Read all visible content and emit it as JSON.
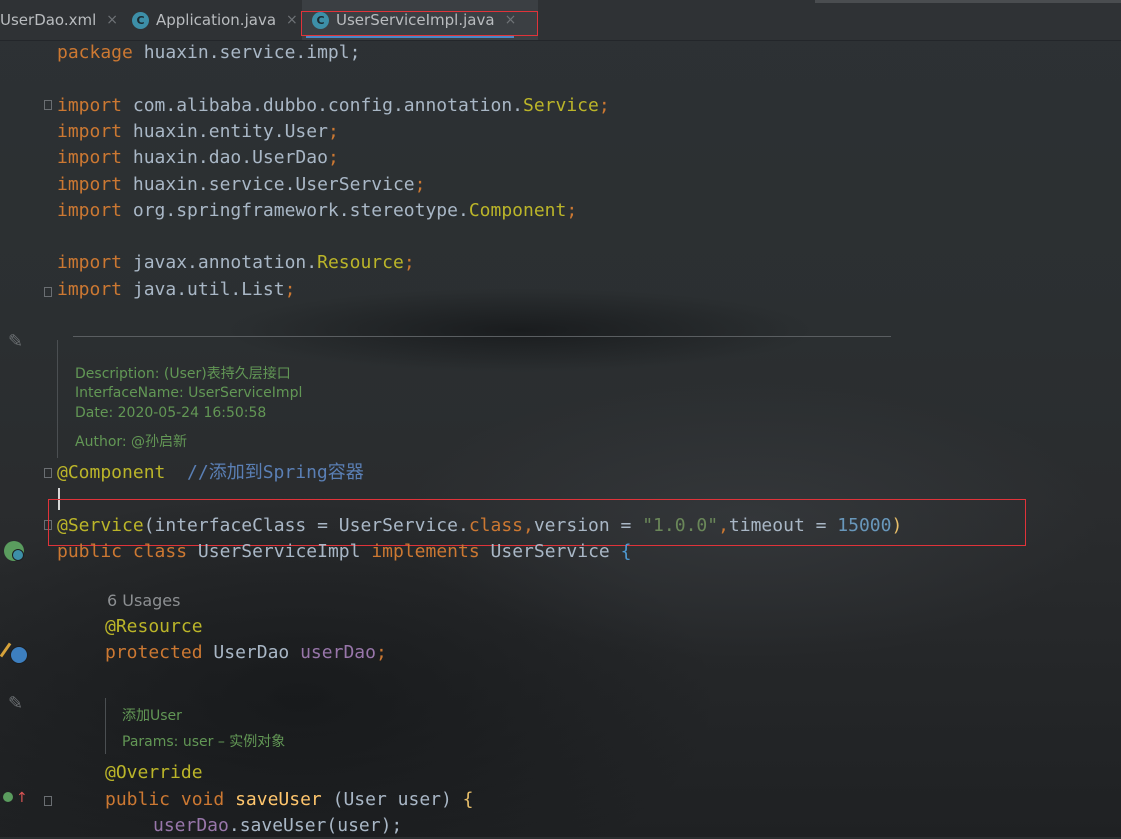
{
  "tabs": [
    {
      "label": "UserDao.xml",
      "close": "×"
    },
    {
      "label": "Application.java",
      "close": "×"
    },
    {
      "label": "UserServiceImpl.java",
      "close": "×"
    }
  ],
  "code": {
    "package_kw": "package",
    "package_name": " huaxin.service.impl;",
    "import_kw": "import",
    "imports": [
      {
        "path": " com.alibaba.dubbo.config.annotation.",
        "cls": "Service",
        "end": ";"
      },
      {
        "path": " huaxin.entity.User",
        "cls": "",
        "end": ";"
      },
      {
        "path": " huaxin.dao.UserDao",
        "cls": "",
        "end": ";"
      },
      {
        "path": " huaxin.service.UserService",
        "cls": "",
        "end": ";"
      },
      {
        "path": " org.springframework.stereotype.",
        "cls": "Component",
        "end": ";"
      },
      {
        "path": " javax.annotation.",
        "cls": "Resource",
        "end": ";"
      },
      {
        "path": " java.util.List",
        "cls": "",
        "end": ";"
      }
    ],
    "doc1": {
      "description": "Description: (User)表持久层接口",
      "interface_name": "InterfaceName: UserServiceImpl",
      "date": "Date: 2020-05-24 16:50:58",
      "author": "Author: @孙启新"
    },
    "component_ann": "@Component",
    "component_comment": "  //添加到Spring容器",
    "service_ann": "@Service",
    "service_args": {
      "open": "(interfaceClass = UserService.",
      "class_kw": "class",
      "comma1": ",",
      "version": "version = ",
      "version_val": "\"1.0.0\"",
      "comma2": ",",
      "timeout": "timeout = ",
      "timeout_val": "15000",
      "close": ")"
    },
    "class_decl": {
      "public": "public",
      "class": "class",
      "name": "UserServiceImpl",
      "implements": "implements",
      "iface": "UserService",
      "brace": "{"
    },
    "usages": "6 Usages",
    "resource_ann": "@Resource",
    "field": {
      "modifier": "protected",
      "type": "UserDao",
      "name": "userDao",
      "end": ";"
    },
    "doc2": {
      "title": "添加User",
      "params_label": "Params:",
      "params_value": " user – 实例对象"
    },
    "override_ann": "@Override",
    "method": {
      "public": "public",
      "void": "void",
      "name": "saveUser",
      "params": " (User user) ",
      "brace": "{"
    },
    "body": {
      "field": "userDao",
      "call": ".saveUser(user);"
    }
  },
  "colors": {
    "keyword": "#cc7832",
    "annotation": "#bbb529",
    "string": "#6a8759",
    "number": "#6897bb",
    "field": "#9876aa",
    "plain": "#a9b7c6",
    "highlight_box": "#e0333a"
  },
  "gutter_icons": [
    "pencil-icon",
    "spring-bean-icon",
    "pencil-icon",
    "override-icon"
  ]
}
